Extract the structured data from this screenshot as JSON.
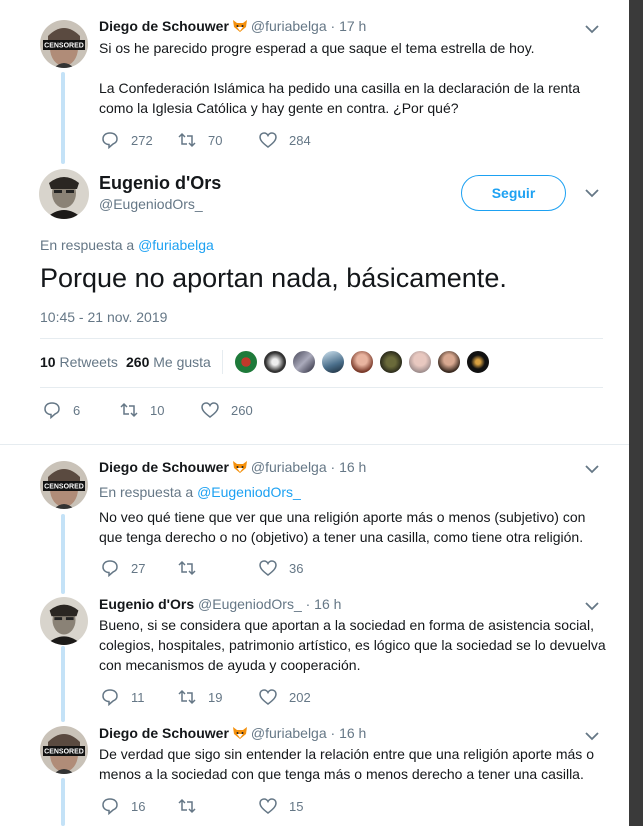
{
  "tweets": [
    {
      "name": "Diego de Schouwer",
      "handle": "@furiabelga",
      "time": "· 17 h",
      "avatar_label": "CENSORED",
      "lines": [
        "Si os he parecido progre esperad a que saque el tema estrella de hoy.",
        "",
        "La Confederación Islámica ha pedido una casilla en la declaración de la renta",
        "como la Iglesia Católica y hay gente en contra. ¿Por qué?"
      ],
      "replies": "272",
      "retweets": "70",
      "likes": "284"
    }
  ],
  "main": {
    "name": "Eugenio d'Ors",
    "handle": "@EugeniodOrs_",
    "follow_label": "Seguir",
    "reply_prefix": "En respuesta a",
    "reply_handle": "@furiabelga",
    "text": "Porque no aportan nada, básicamente.",
    "timestamp": "10:45 - 21 nov. 2019",
    "retweets_count": "10",
    "retweets_label": "Retweets",
    "likes_count": "260",
    "likes_label": "Me gusta",
    "replies": "6",
    "retweets": "10",
    "likes": "260"
  },
  "replies": [
    {
      "name": "Diego de Schouwer",
      "handle": "@furiabelga",
      "time": "· 16 h",
      "avatar_label": "CENSORED",
      "reply_prefix": "En respuesta a",
      "reply_handle": "@EugeniodOrs_",
      "lines": [
        "No veo qué tiene que ver que una religión aporte más o menos (subjetivo) con",
        "que tenga derecho o no (objetivo) a tener una casilla, como tiene otra religión."
      ],
      "replies": "27",
      "retweets": "",
      "likes": "36"
    },
    {
      "name": "Eugenio d'Ors",
      "handle": "@EugeniodOrs_",
      "time": "· 16 h",
      "lines": [
        "Bueno, si se considera que aportan a la sociedad en forma de asistencia social,",
        "colegios, hospitales, patrimonio artístico, es lógico que la sociedad se lo devuelva",
        "con mecanismos de ayuda y cooperación."
      ],
      "replies": "11",
      "retweets": "19",
      "likes": "202"
    },
    {
      "name": "Diego de Schouwer",
      "handle": "@furiabelga",
      "time": "· 16 h",
      "avatar_label": "CENSORED",
      "lines": [
        "De verdad que sigo sin entender la relación entre que una religión aporte más o",
        "menos a la sociedad con que tenga más o menos derecho a tener una casilla."
      ],
      "replies": "16",
      "retweets": "",
      "likes": "15"
    }
  ],
  "colors": {
    "accent": "#1da1f2",
    "muted": "#657786",
    "thread": "#c4e2f7"
  }
}
